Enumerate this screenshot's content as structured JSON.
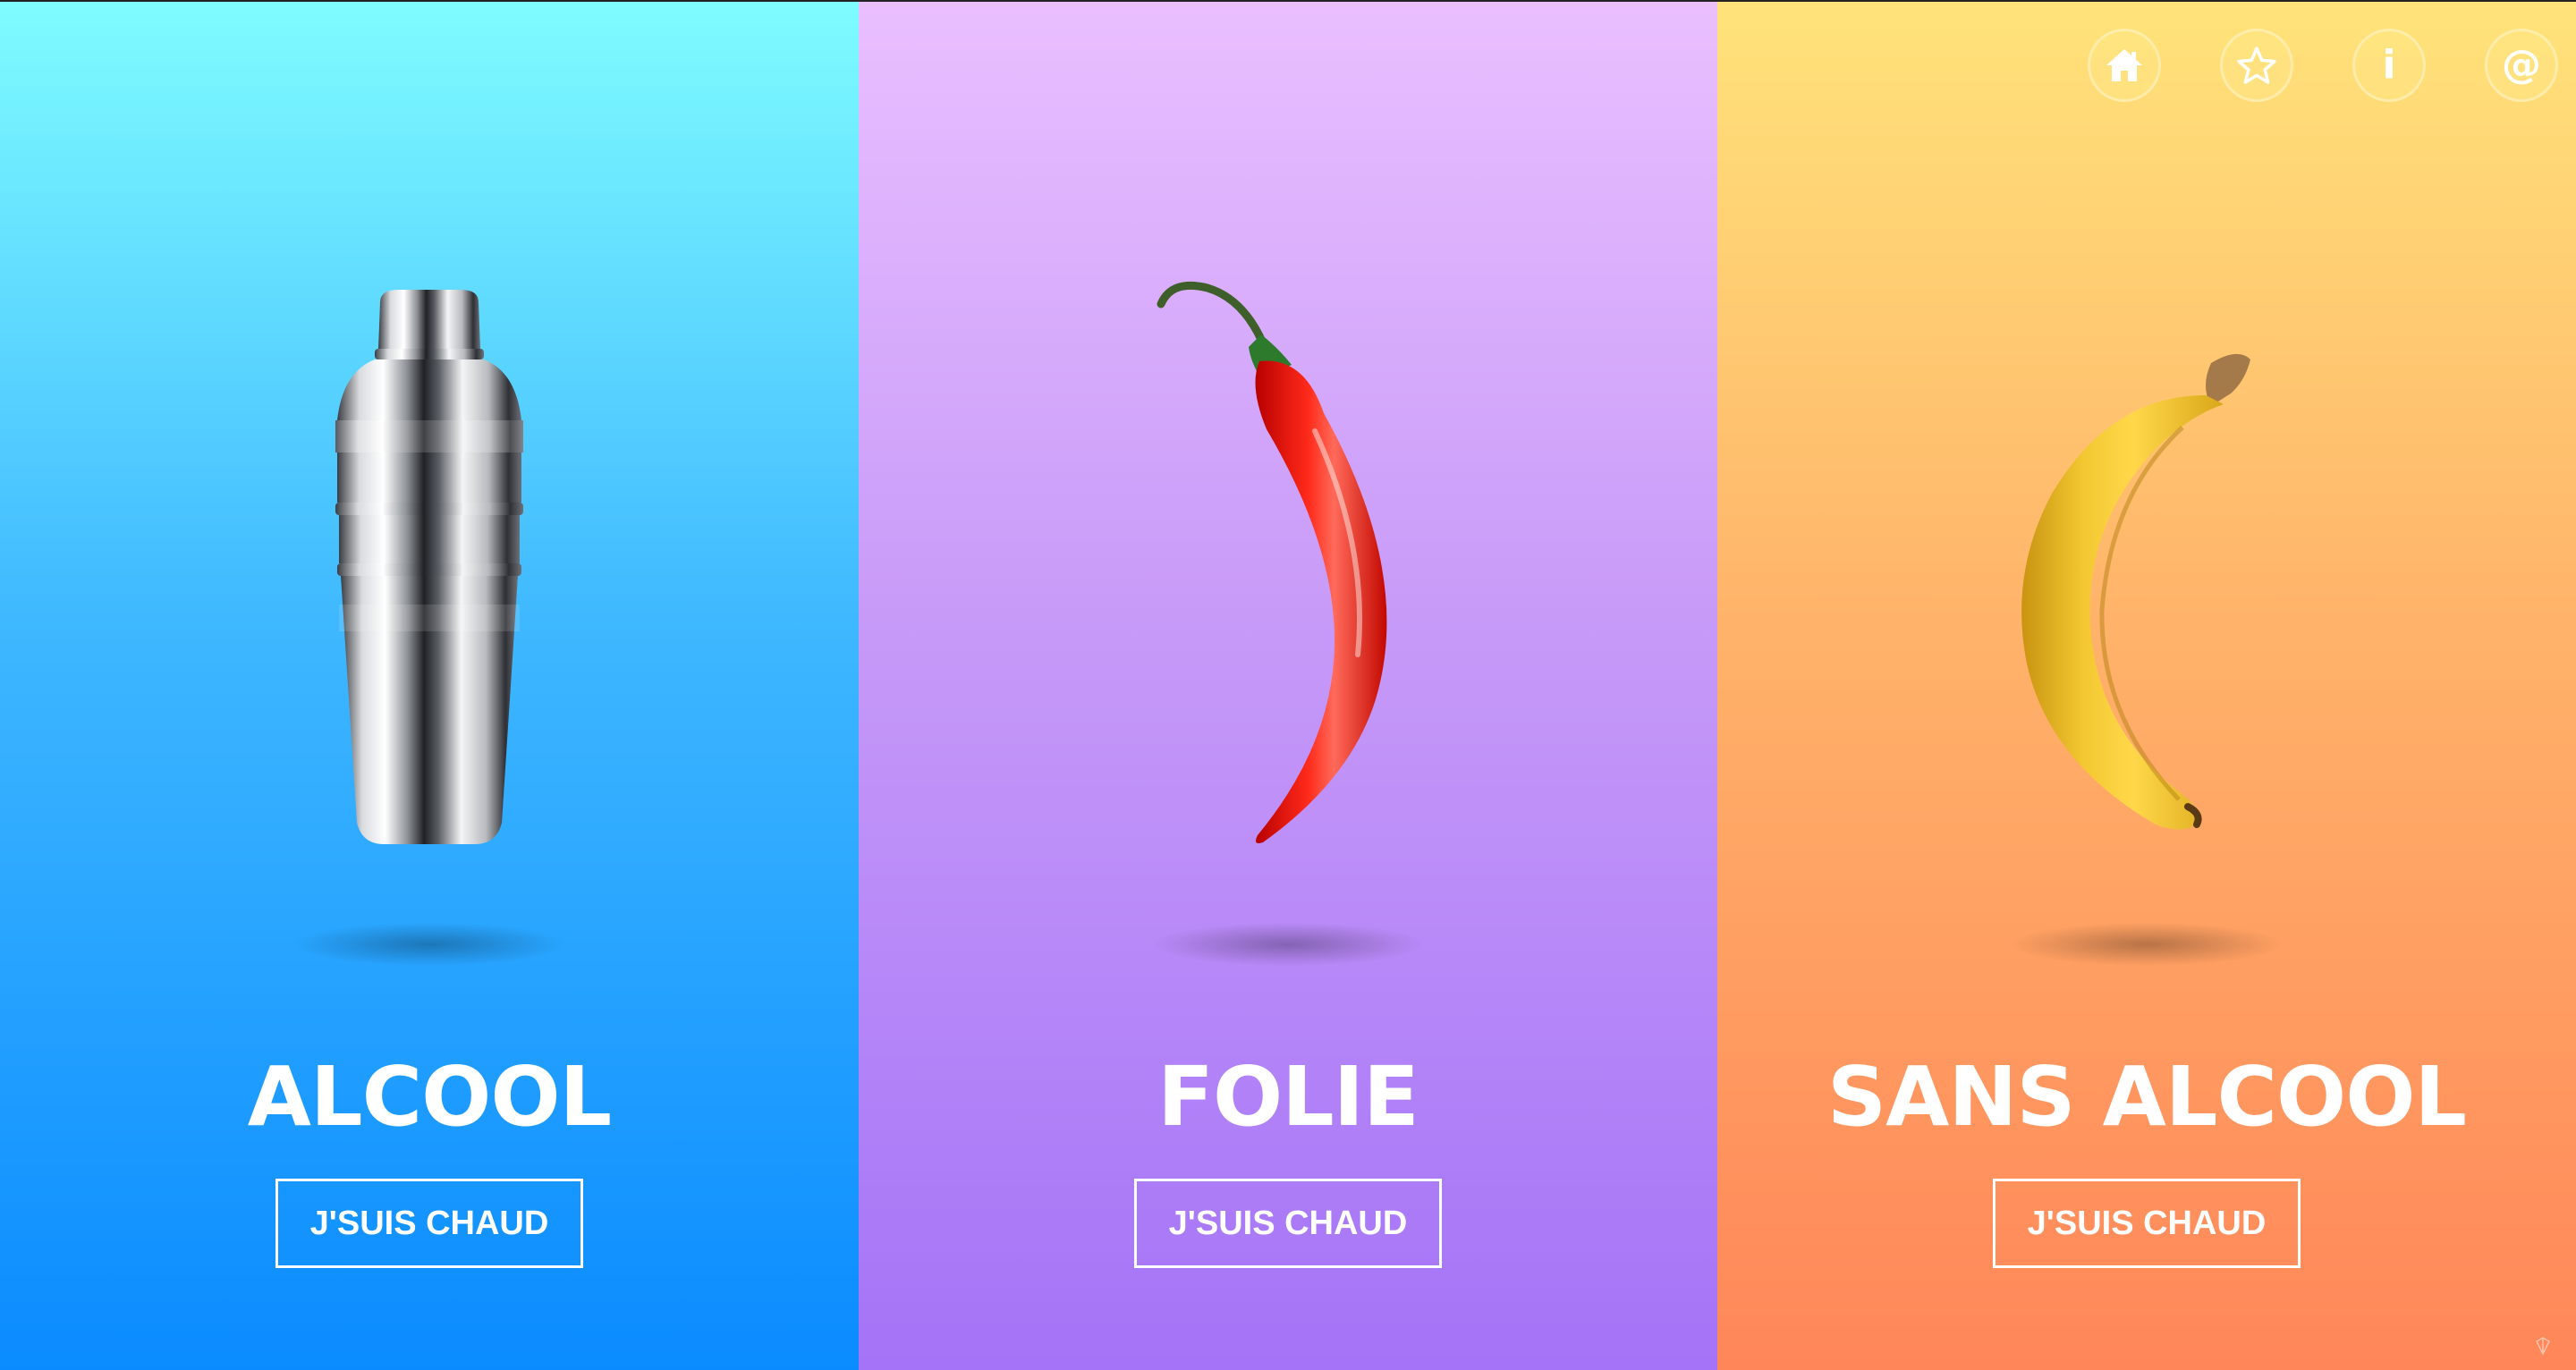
{
  "panels": [
    {
      "id": "alcool",
      "title": "ALCOOL",
      "cta_label": "J'SUIS CHAUD",
      "image_icon": "cocktail-shaker-icon",
      "gradient": [
        "#7ffcff",
        "#0a8bff"
      ]
    },
    {
      "id": "folie",
      "title": "FOLIE",
      "cta_label": "J'SUIS CHAUD",
      "image_icon": "chili-pepper-icon",
      "gradient": [
        "#eabfff",
        "#a473f7"
      ]
    },
    {
      "id": "sans-alcool",
      "title": "SANS ALCOOL",
      "cta_label": "J'SUIS CHAUD",
      "image_icon": "banana-icon",
      "gradient": [
        "#ffe37a",
        "#ff8659"
      ]
    }
  ],
  "nav": {
    "items": [
      {
        "icon": "home-icon"
      },
      {
        "icon": "star-icon"
      },
      {
        "icon": "info-icon",
        "glyph": "i"
      },
      {
        "icon": "at-icon",
        "glyph": "@"
      }
    ]
  },
  "colors": {
    "text": "#ffffff",
    "nav_button_fill": "#ffe88c"
  }
}
